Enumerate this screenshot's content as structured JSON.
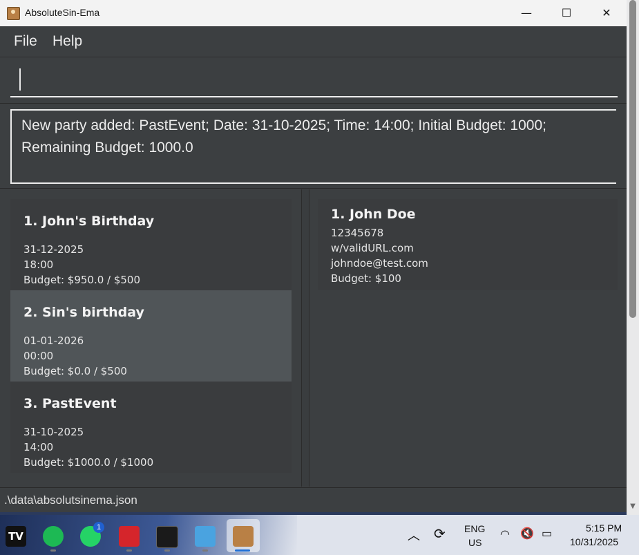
{
  "window": {
    "title": "AbsoluteSin-Ema",
    "minimize_symbol": "—",
    "maximize_symbol": "☐",
    "close_symbol": "✕"
  },
  "menu": {
    "file": "File",
    "help": "Help"
  },
  "command": {
    "value": ""
  },
  "result": {
    "message": "New party added: PastEvent; Date: 31-10-2025; Time: 14:00; Initial Budget: 1000; Remaining Budget: 1000.0"
  },
  "parties": [
    {
      "name": "1. John's Birthday",
      "date": "31-12-2025",
      "time": "18:00",
      "budget": "Budget: $950.0 / $500",
      "selected": false
    },
    {
      "name": "2. Sin's birthday",
      "date": "01-01-2026",
      "time": "00:00",
      "budget": "Budget: $0.0 / $500",
      "selected": true
    },
    {
      "name": "3. PastEvent",
      "date": "31-10-2025",
      "time": "14:00",
      "budget": "Budget: $1000.0 / $1000",
      "selected": false
    }
  ],
  "persons": [
    {
      "name": "1. John Doe",
      "phone": "12345678",
      "address": "w/validURL.com",
      "email": "johndoe@test.com",
      "budget": "Budget: $100"
    }
  ],
  "status": {
    "path": ".\\data\\absolutsinema.json"
  },
  "taskbar": {
    "apps": [
      "tradingview-icon",
      "spotify-icon",
      "whatsapp-icon",
      "acrobat-icon",
      "terminal-icon",
      "notepad-icon",
      "addressbook-icon"
    ],
    "whatsapp_badge": "1",
    "language": "ENG",
    "region": "US",
    "time": "5:15 PM",
    "date": "10/31/2025"
  },
  "colors": {
    "window_bg": "#3c3f41",
    "card_selected": "#505558",
    "card_normal": "#3a3c3e"
  }
}
